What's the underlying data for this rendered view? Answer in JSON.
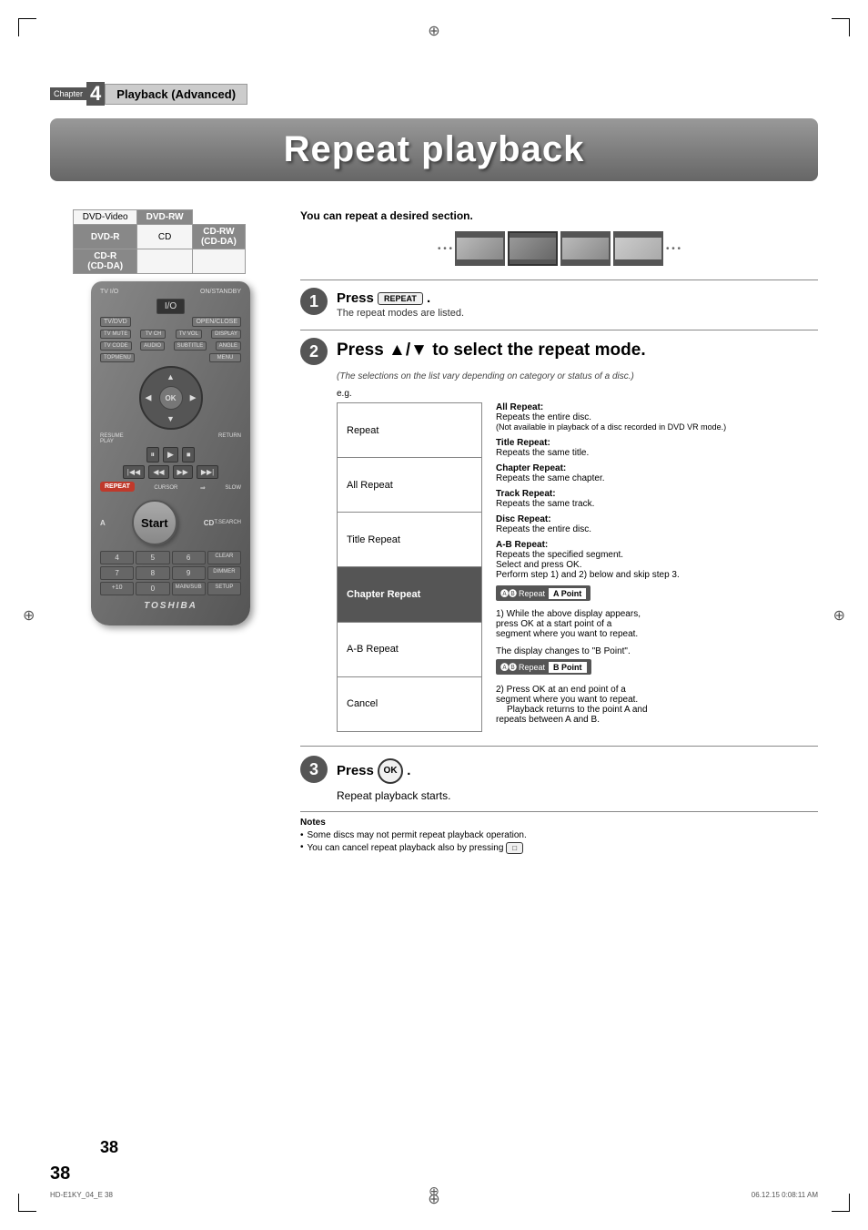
{
  "page": {
    "number": "38",
    "footer_left": "HD-E1KY_04_E  38",
    "footer_right": "06.12.15  0:08:11 AM"
  },
  "chapter": {
    "label": "Chapter",
    "number": "4",
    "title": "Playback (Advanced)"
  },
  "title": "Repeat playback",
  "intro": "You can repeat a desired section.",
  "disc_compatibility": {
    "rows": [
      [
        "DVD-Video",
        "DVD-RW"
      ],
      [
        "DVD-R",
        "CD",
        "CD-RW\n(CD-DA)"
      ],
      [
        "CD-R\n(CD-DA)",
        "",
        ""
      ]
    ]
  },
  "steps": {
    "step1": {
      "number": "1",
      "press_label": "Press",
      "key_label": "REPEAT",
      "sub_text": "The repeat modes are listed."
    },
    "step2": {
      "number": "2",
      "instruction": "Press ▲/▼ to select the repeat mode.",
      "italic_note": "(The selections on the list vary depending on category or status of a disc.)",
      "eg_label": "e.g.",
      "modes": [
        "Repeat",
        "All Repeat",
        "Title Repeat",
        "Chapter Repeat",
        "A-B Repeat",
        "Cancel"
      ],
      "highlighted_mode": "Chapter Repeat",
      "descriptions": [
        {
          "title": "All Repeat:",
          "text": "Repeats the entire disc.\n(Not available in playback of a disc recorded in\nDVD VR mode.)"
        },
        {
          "title": "Title Repeat:",
          "text": "Repeats the same title."
        },
        {
          "title": "Chapter Repeat:",
          "text": "Repeats the same chapter."
        },
        {
          "title": "Track Repeat:",
          "text": "Repeats the same track."
        },
        {
          "title": "Disc Repeat:",
          "text": "Repeats the entire disc."
        },
        {
          "title": "A-B Repeat:",
          "text": "Repeats the specified segment.\nSelect and press OK.\nPerform step 1) and 2) below and skip\nstep 3."
        }
      ],
      "ab_steps": [
        {
          "number": "1)",
          "text": "While the above display appears,\npress OK at a start point of a\nsegment where you want to repeat.",
          "display_text": "The display changes to \"B Point\".",
          "display_label_a": "A Point"
        },
        {
          "number": "2)",
          "text": "Press OK at an end point of a\nsegment where you want to repeat.",
          "note": "Playback returns to the point A and\nrepeats between A and B.",
          "display_label_b": "B Point"
        }
      ],
      "ab_display_prefix": "AB",
      "ab_display_repeat": "Repeat"
    },
    "step3": {
      "number": "3",
      "press_label": "Press",
      "key_label": "OK",
      "sub_text": "Repeat playback starts."
    }
  },
  "notes": {
    "title": "Notes",
    "items": [
      "Some discs may not permit repeat playback operation.",
      "You can cancel repeat playback also by pressing"
    ]
  },
  "remote": {
    "brand": "TOSHIBA",
    "start_label": "Start",
    "buttons": {
      "tv_io": "TV I/O",
      "on_standby": "ON/STANDBY",
      "io_btn": "I/O",
      "tv_dvd": "TV/DVD",
      "open_close": "OPEN/CLOSE",
      "tv_mute": "TV MUTE",
      "tv_ch": "TV CH",
      "tv_vol": "TV VOL",
      "display": "DISPLAY",
      "tv_code": "TV CODE",
      "audio": "AUDIO",
      "subtitle": "SUBTITLE",
      "angle": "ANGLE",
      "topmenu": "TOPMENU",
      "menu": "MENU",
      "ok": "OK",
      "resume_play": "RESUME\nPLAY",
      "return": "RETURN",
      "repeat": "REPEAT",
      "cursor": "CURSOR",
      "slow": "SLOW",
      "a": "A",
      "c": "C",
      "d": "D",
      "t_search": "T.SEARCH",
      "clear": "CLEAR",
      "dimmer": "DIMMER",
      "mainsub": "MAIN/SUB",
      "setup": "SETUP"
    }
  }
}
